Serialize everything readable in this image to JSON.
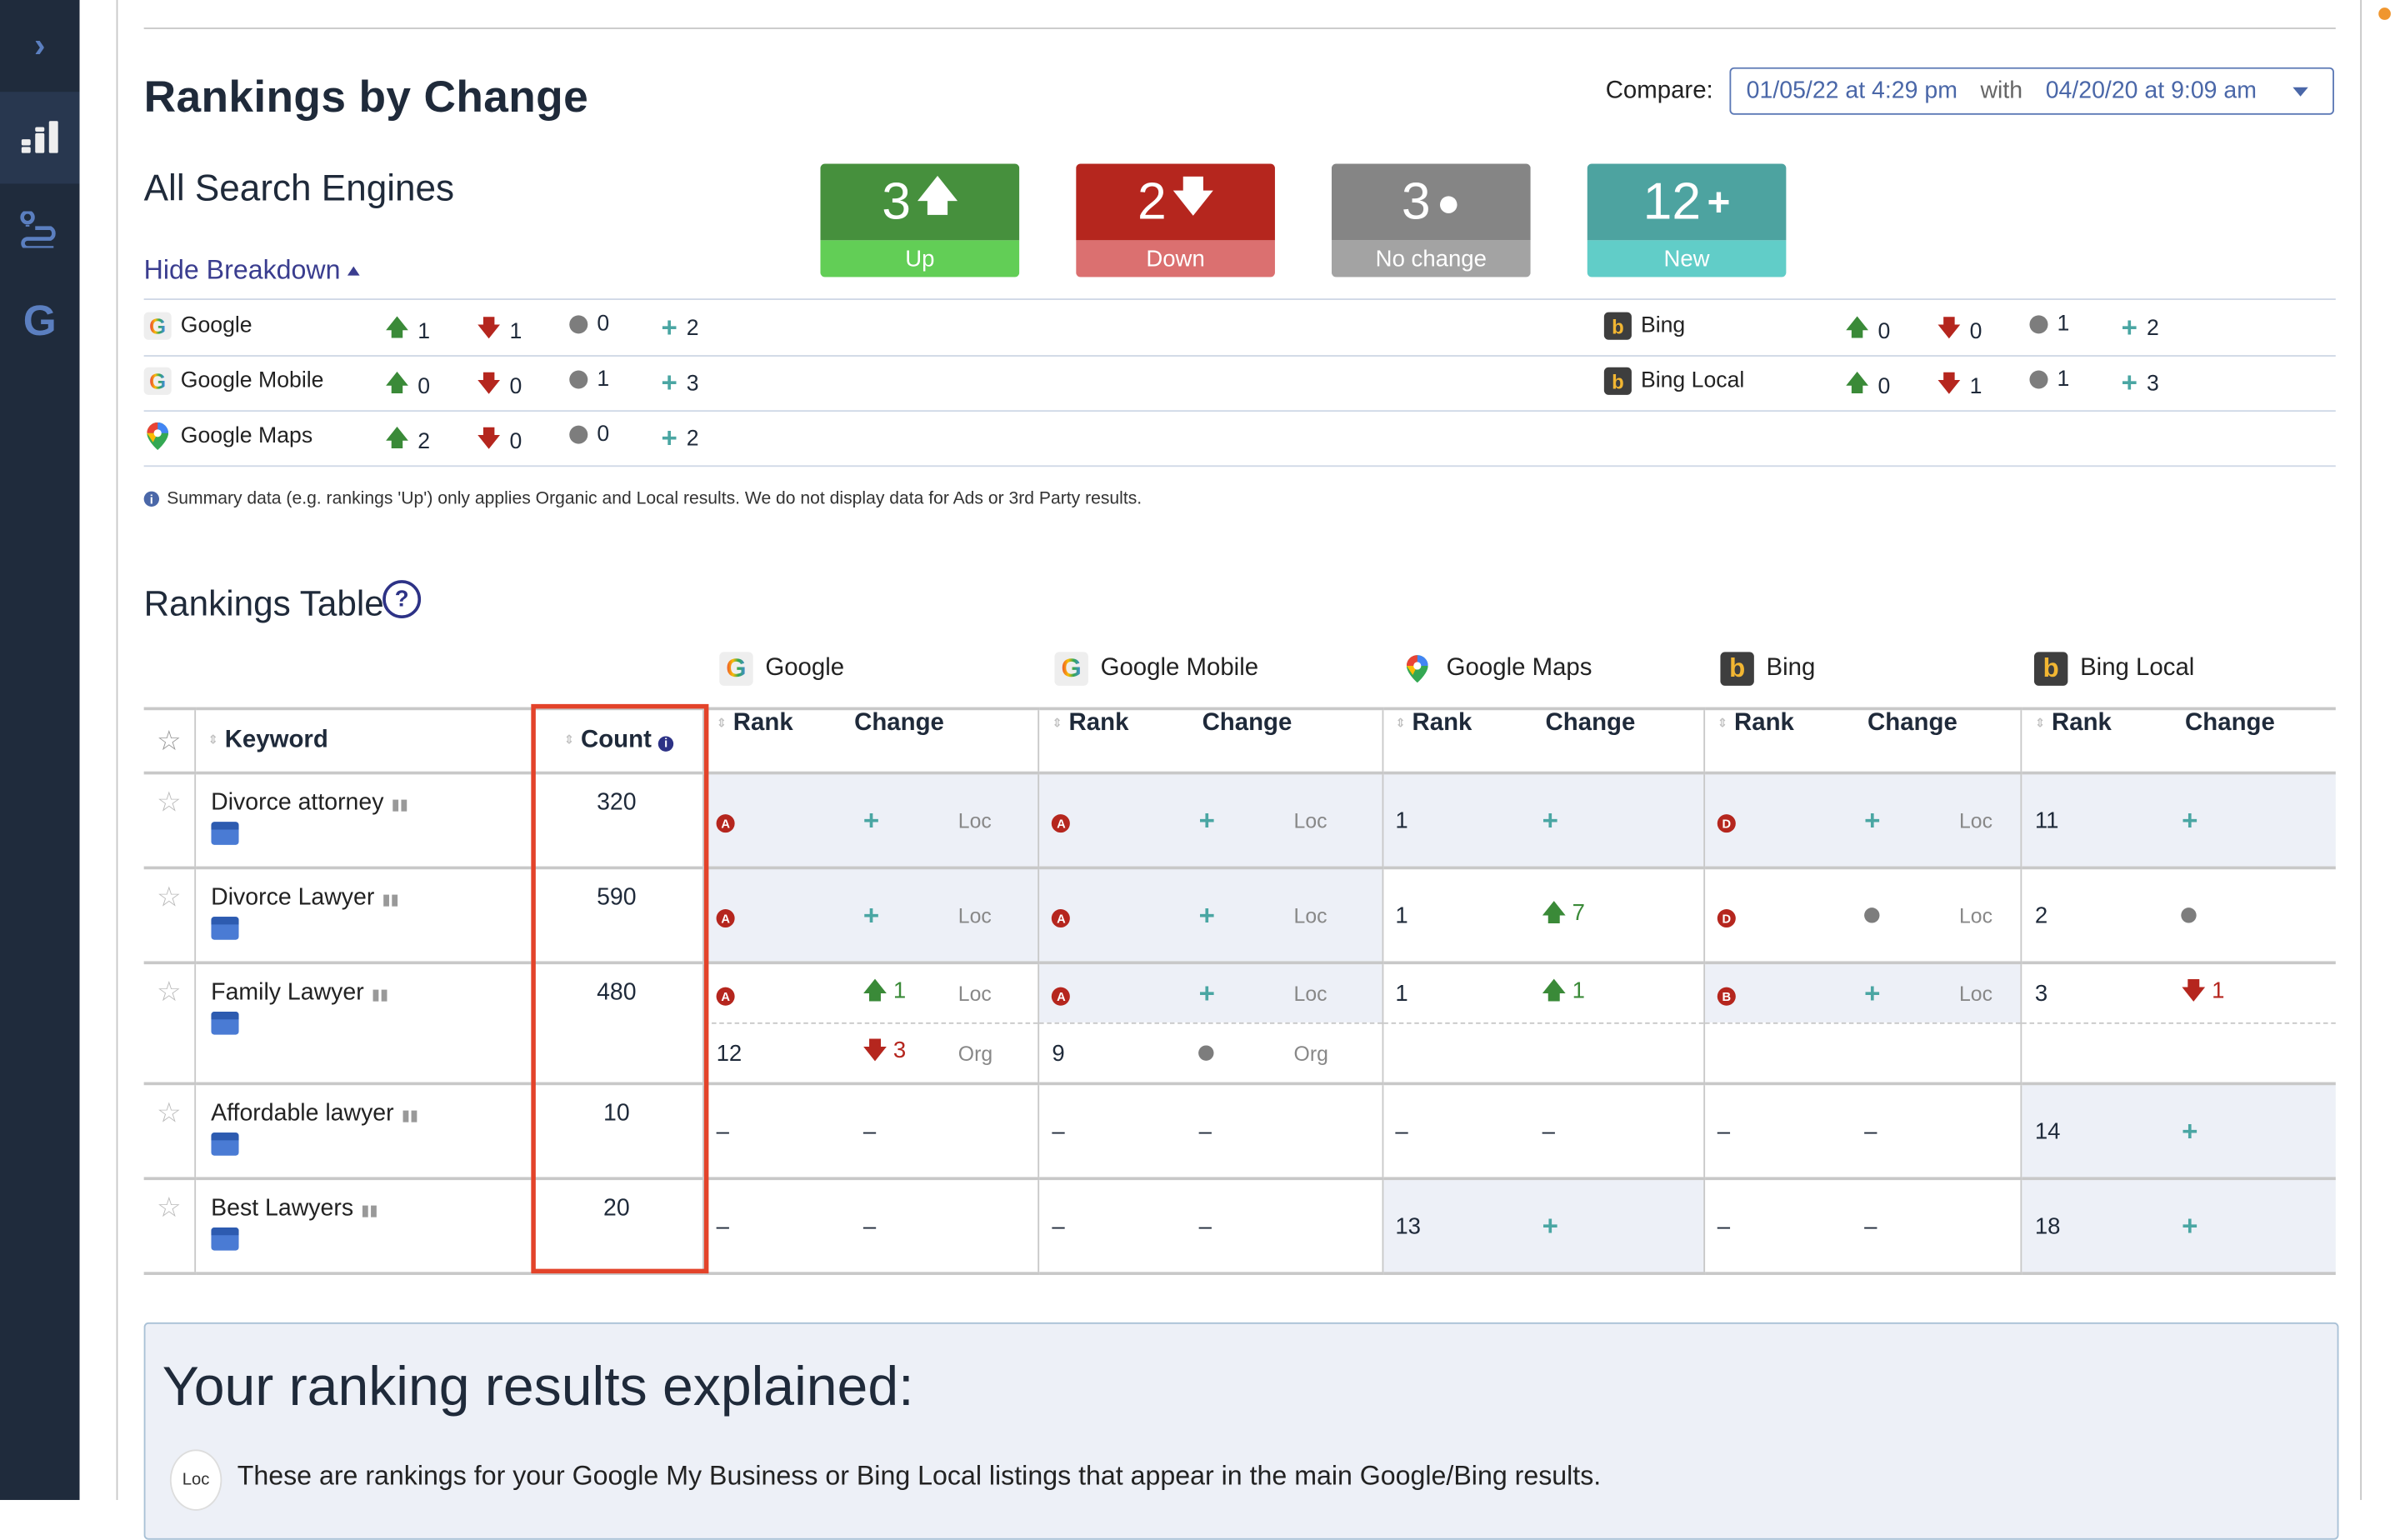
{
  "sidebar": {
    "items": [
      {
        "name": "expand",
        "icon": "chevron-right-icon"
      },
      {
        "name": "rankings",
        "icon": "bar-chart-icon",
        "active": true
      },
      {
        "name": "local-tracker",
        "icon": "route-pin-icon"
      },
      {
        "name": "google",
        "icon": "google-g-icon"
      }
    ]
  },
  "header": {
    "title": "Rankings by Change",
    "compare_label": "Compare:",
    "compare_from": "01/05/22 at 4:29 pm",
    "compare_with": "with",
    "compare_to": "04/20/20 at 9:09 am"
  },
  "summary": {
    "subtitle": "All Search Engines",
    "hide_breakdown": "Hide Breakdown",
    "boxes": [
      {
        "value": "3",
        "glyph": "🡅",
        "label": "Up",
        "color_top": "#46903d",
        "color_bot": "#62ce56"
      },
      {
        "value": "2",
        "glyph": "🡇",
        "label": "Down",
        "color_top": "#b5261e",
        "color_bot": "#db7070"
      },
      {
        "value": "3",
        "glyph": "●",
        "label": "No change",
        "color_top": "#858585",
        "color_bot": "#a3a3a3"
      },
      {
        "value": "12",
        "glyph": "+",
        "label": "New",
        "color_top": "#4da3a0",
        "color_bot": "#61cdc8"
      }
    ],
    "breakdown": [
      {
        "engine": "Google",
        "icon": "G",
        "up": "1",
        "down": "1",
        "same": "0",
        "new": "2"
      },
      {
        "engine": "Google Mobile",
        "icon": "G",
        "up": "0",
        "down": "0",
        "same": "1",
        "new": "3"
      },
      {
        "engine": "Google Maps",
        "icon": "pin",
        "up": "2",
        "down": "0",
        "same": "0",
        "new": "2"
      },
      {
        "engine": "Bing",
        "icon": "b",
        "up": "0",
        "down": "0",
        "same": "1",
        "new": "2"
      },
      {
        "engine": "Bing Local",
        "icon": "b",
        "up": "0",
        "down": "1",
        "same": "1",
        "new": "3"
      }
    ],
    "note": "Summary data (e.g. rankings 'Up') only applies Organic and Local results. We do not display data for Ads or 3rd Party results."
  },
  "table": {
    "title": "Rankings Table",
    "engines": [
      "Google",
      "Google Mobile",
      "Google Maps",
      "Bing",
      "Bing Local"
    ],
    "headers": {
      "keyword": "Keyword",
      "count": "Count",
      "rank": "Rank",
      "change": "Change"
    },
    "rows": [
      {
        "keyword": "Divorce attorney",
        "count": "320",
        "cells": [
          {
            "rank": "A",
            "rank_badge": true,
            "change": "+",
            "change_type": "new",
            "type": "Loc",
            "hl": true
          },
          {
            "rank": "A",
            "rank_badge": true,
            "change": "+",
            "change_type": "new",
            "type": "Loc",
            "hl": true
          },
          {
            "rank": "1",
            "change": "+",
            "change_type": "new",
            "type": "",
            "hl": true
          },
          {
            "rank": "D",
            "rank_badge": true,
            "change": "+",
            "change_type": "new",
            "type": "Loc",
            "hl": true
          },
          {
            "rank": "11",
            "change": "+",
            "change_type": "new",
            "type": "",
            "hl": true
          }
        ]
      },
      {
        "keyword": "Divorce Lawyer",
        "count": "590",
        "cells": [
          {
            "rank": "A",
            "rank_badge": true,
            "change": "+",
            "change_type": "new",
            "type": "Loc",
            "hl": true
          },
          {
            "rank": "A",
            "rank_badge": true,
            "change": "+",
            "change_type": "new",
            "type": "Loc",
            "hl": true
          },
          {
            "rank": "1",
            "change": "7",
            "change_type": "up",
            "type": "",
            "hl": false
          },
          {
            "rank": "D",
            "rank_badge": true,
            "change": "",
            "change_type": "same",
            "type": "Loc",
            "hl": false
          },
          {
            "rank": "2",
            "change": "",
            "change_type": "same",
            "type": "",
            "hl": false
          }
        ]
      },
      {
        "keyword": "Family Lawyer",
        "count": "480",
        "cells": [
          {
            "rank": "A",
            "rank_badge": true,
            "change": "1",
            "change_type": "up",
            "type": "Loc",
            "hl": false
          },
          {
            "rank": "A",
            "rank_badge": true,
            "change": "+",
            "change_type": "new",
            "type": "Loc",
            "hl": true
          },
          {
            "rank": "1",
            "change": "1",
            "change_type": "up",
            "type": "",
            "hl": false
          },
          {
            "rank": "B",
            "rank_badge": true,
            "change": "+",
            "change_type": "new",
            "type": "Loc",
            "hl": true
          },
          {
            "rank": "3",
            "change": "1",
            "change_type": "down",
            "type": "",
            "hl": false
          }
        ],
        "second": [
          {
            "rank": "12",
            "change": "3",
            "change_type": "down",
            "type": "Org"
          },
          {
            "rank": "9",
            "change": "",
            "change_type": "same",
            "type": "Org"
          },
          {
            "rank": "",
            "change": "",
            "change_type": "",
            "type": ""
          },
          {
            "rank": "",
            "change": "",
            "change_type": "",
            "type": ""
          },
          {
            "rank": "",
            "change": "",
            "change_type": "",
            "type": ""
          }
        ]
      },
      {
        "keyword": "Affordable lawyer",
        "count": "10",
        "cells": [
          {
            "rank": "–",
            "change": "–",
            "change_type": "none",
            "type": "",
            "hl": false
          },
          {
            "rank": "–",
            "change": "–",
            "change_type": "none",
            "type": "",
            "hl": false
          },
          {
            "rank": "–",
            "change": "–",
            "change_type": "none",
            "type": "",
            "hl": false
          },
          {
            "rank": "–",
            "change": "–",
            "change_type": "none",
            "type": "",
            "hl": false
          },
          {
            "rank": "14",
            "change": "+",
            "change_type": "new",
            "type": "",
            "hl": true
          }
        ]
      },
      {
        "keyword": "Best Lawyers",
        "count": "20",
        "cells": [
          {
            "rank": "–",
            "change": "–",
            "change_type": "none",
            "type": "",
            "hl": false
          },
          {
            "rank": "–",
            "change": "–",
            "change_type": "none",
            "type": "",
            "hl": false
          },
          {
            "rank": "13",
            "change": "+",
            "change_type": "new",
            "type": "",
            "hl": true
          },
          {
            "rank": "–",
            "change": "–",
            "change_type": "none",
            "type": "",
            "hl": false
          },
          {
            "rank": "18",
            "change": "+",
            "change_type": "new",
            "type": "",
            "hl": true
          }
        ]
      }
    ]
  },
  "explain": {
    "title": "Your ranking results explained:",
    "loc_badge": "Loc",
    "loc_text": "These are rankings for your Google My Business or Bing Local listings that appear in the main Google/Bing results."
  },
  "colors": {
    "accent": "#3a3d8f",
    "up": "#3a8a38",
    "down": "#b5261e",
    "new": "#4aa6a3",
    "highlight": "#e3432a"
  }
}
